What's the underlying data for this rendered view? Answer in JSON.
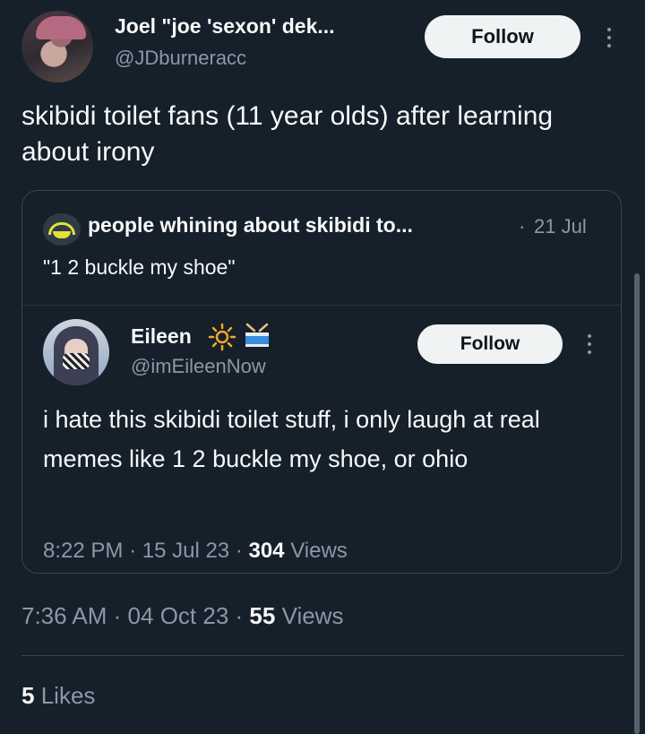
{
  "author": {
    "display_name": "Joel \"joe 'sexon' dek...",
    "handle": "@JDburneracc",
    "follow_label": "Follow"
  },
  "tweet": {
    "text": "skibidi toilet fans (11 year olds) after learning about irony",
    "time": "7:36 AM",
    "date": "04 Oct 23",
    "views_count": "55",
    "views_label": "Views",
    "likes_count": "5",
    "likes_label": "Likes"
  },
  "quote": {
    "author_name": "people whining about skibidi to...",
    "date": "21 Jul",
    "text": "\"1 2 buckle my shoe\""
  },
  "nested": {
    "display_name": "Eileen",
    "handle": "@imEileenNow",
    "follow_label": "Follow",
    "text": "i hate this skibidi toilet stuff, i only laugh at real memes like 1 2 buckle my shoe, or ohio",
    "time": "8:22 PM",
    "date": "15 Jul 23",
    "views_count": "304",
    "views_label": "Views",
    "emoji": [
      "sun-icon",
      "drum-icon"
    ]
  },
  "separator": "·",
  "colors": {
    "background": "#15202b",
    "text": "#f7f9f9",
    "muted": "#8b98a5",
    "border": "#38444d",
    "button": "#eff3f4"
  }
}
